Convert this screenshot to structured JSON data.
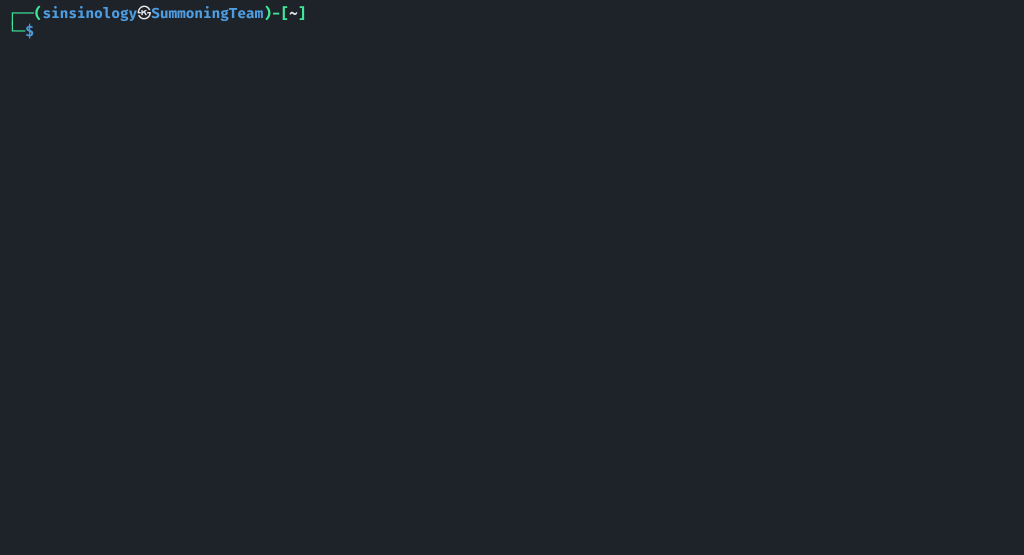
{
  "prompt": {
    "line1_prefix": "┌──",
    "paren_open": "(",
    "user": "sinsinology",
    "separator_icon": "㉿",
    "host": "SummoningTeam",
    "paren_close": ")",
    "dash": "-",
    "bracket_open": "[",
    "cwd": "~",
    "bracket_close": "]",
    "line2_prefix": "└─",
    "symbol": "$"
  }
}
